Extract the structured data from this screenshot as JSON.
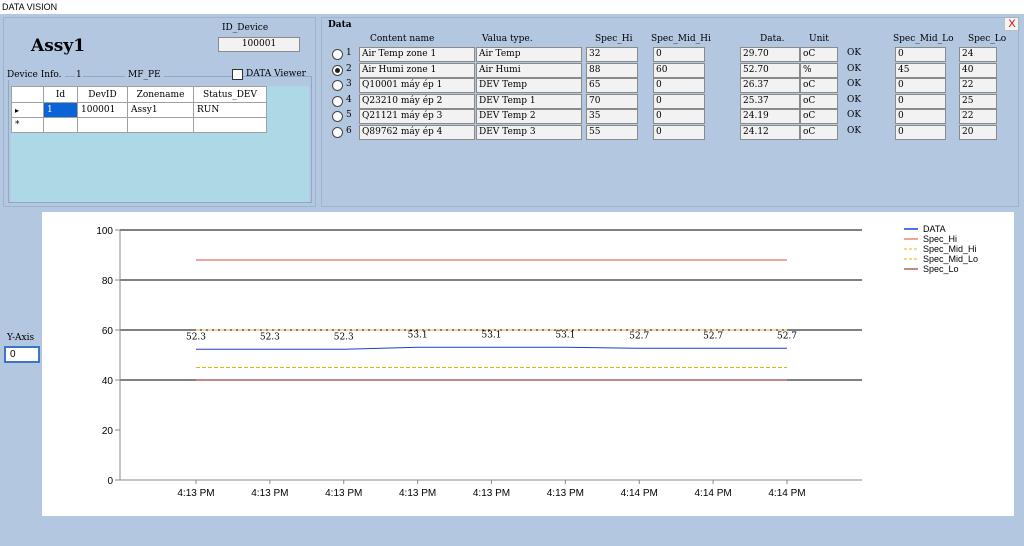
{
  "window": {
    "title": "DATA VISION",
    "close_label": "X"
  },
  "device": {
    "name": "Assy1",
    "id_label": "ID_Device",
    "id_value": "100001",
    "info_label": "Device Info.",
    "info_index": "1",
    "info_group": "MF_PE",
    "viewer_label": "DATA Viewer",
    "viewer_checked": false,
    "grid": {
      "columns": [
        "Id",
        "DevID",
        "Zonename",
        "Status_DEV"
      ],
      "rows": [
        {
          "marker": "▸",
          "cells": [
            "1",
            "100001",
            "Assy1",
            "RUN"
          ]
        }
      ],
      "new_row_marker": "*"
    }
  },
  "data_panel": {
    "title": "Data",
    "headers": {
      "content": "Content name",
      "type": "Valua type.",
      "spec_hi": "Spec_Hi",
      "spec_mid_hi": "Spec_Mid_Hi",
      "data": "Data.",
      "unit": "Unit",
      "spec_mid_lo": "Spec_Mid_Lo",
      "spec_lo": "Spec_Lo"
    },
    "rows": [
      {
        "num": "1",
        "selected": false,
        "content": "Air Temp zone 1",
        "type": "Air Temp",
        "spec_hi": "32",
        "spec_mid_hi": "0",
        "data": "29.70",
        "unit": "oC",
        "status": "OK",
        "spec_mid_lo": "0",
        "spec_lo": "24"
      },
      {
        "num": "2",
        "selected": true,
        "content": "Air Humi zone 1",
        "type": "Air Humi",
        "spec_hi": "88",
        "spec_mid_hi": "60",
        "data": "52.70",
        "unit": "%",
        "status": "OK",
        "spec_mid_lo": "45",
        "spec_lo": "40"
      },
      {
        "num": "3",
        "selected": false,
        "content": "Q10001 máy ép 1",
        "type": "DEV Temp",
        "spec_hi": "65",
        "spec_mid_hi": "0",
        "data": "26.37",
        "unit": "oC",
        "status": "OK",
        "spec_mid_lo": "0",
        "spec_lo": "22"
      },
      {
        "num": "4",
        "selected": false,
        "content": "Q23210 máy ép 2",
        "type": "DEV Temp 1",
        "spec_hi": "70",
        "spec_mid_hi": "0",
        "data": "25.37",
        "unit": "oC",
        "status": "OK",
        "spec_mid_lo": "0",
        "spec_lo": "25"
      },
      {
        "num": "5",
        "selected": false,
        "content": "Q21121 máy ép 3",
        "type": "DEV Temp 2",
        "spec_hi": "35",
        "spec_mid_hi": "0",
        "data": "24.19",
        "unit": "oC",
        "status": "OK",
        "spec_mid_lo": "0",
        "spec_lo": "22"
      },
      {
        "num": "6",
        "selected": false,
        "content": "Q89762 máy ép 4",
        "type": "DEV Temp 3",
        "spec_hi": "55",
        "spec_mid_hi": "0",
        "data": "24.12",
        "unit": "oC",
        "status": "OK",
        "spec_mid_lo": "0",
        "spec_lo": "20"
      }
    ]
  },
  "yaxis_control": {
    "label": "Y-Axis",
    "value": "0"
  },
  "chart_data": {
    "type": "line",
    "ylim": [
      0,
      100
    ],
    "yticks": [
      0,
      20,
      40,
      60,
      80,
      100
    ],
    "grid": "horizontal at 40, 60, 80, 100",
    "legend_position": "top-right",
    "categories": [
      "4:13 PM",
      "4:13 PM",
      "4:13 PM",
      "4:13 PM",
      "4:13 PM",
      "4:13 PM",
      "4:14 PM",
      "4:14 PM",
      "4:14 PM"
    ],
    "series": [
      {
        "name": "DATA",
        "color": "#1f3fd4",
        "style": "solid",
        "values": [
          52.3,
          52.3,
          52.3,
          53.1,
          53.1,
          53.1,
          52.7,
          52.7,
          52.7
        ],
        "labels": [
          "52.3",
          "52.3",
          "52.3",
          "53.1",
          "53.1",
          "53.1",
          "52.7",
          "52.7",
          "52.7"
        ]
      },
      {
        "name": "Spec_Hi",
        "color": "#e0483a",
        "style": "solid",
        "values": [
          88,
          88,
          88,
          88,
          88,
          88,
          88,
          88,
          88
        ]
      },
      {
        "name": "Spec_Mid_Hi",
        "color": "#f0b020",
        "style": "dashed",
        "values": [
          60,
          60,
          60,
          60,
          60,
          60,
          60,
          60,
          60
        ]
      },
      {
        "name": "Spec_Mid_Lo",
        "color": "#d4c000",
        "style": "dashed",
        "values": [
          45,
          45,
          45,
          45,
          45,
          45,
          45,
          45,
          45
        ]
      },
      {
        "name": "Spec_Lo",
        "color": "#8b1010",
        "style": "solid",
        "values": [
          40,
          40,
          40,
          40,
          40,
          40,
          40,
          40,
          40
        ]
      }
    ]
  }
}
